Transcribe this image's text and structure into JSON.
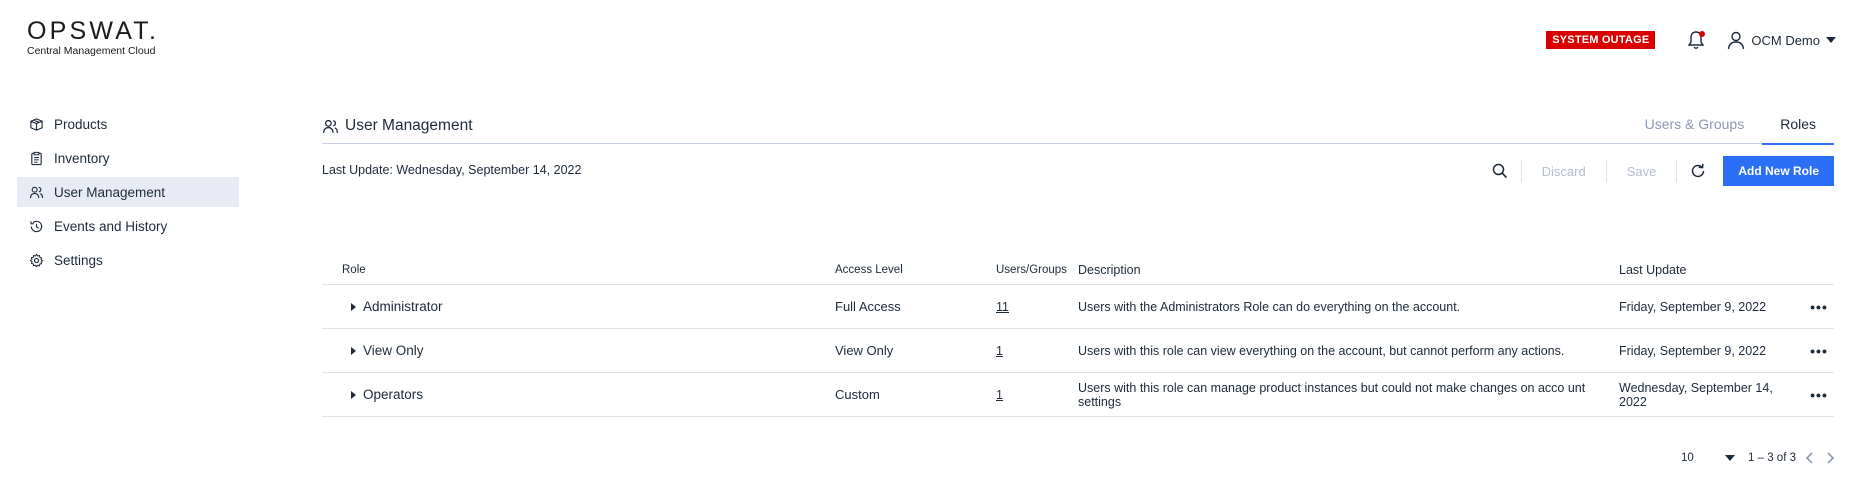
{
  "brand": {
    "name": "OPSWAT.",
    "subtitle": "Central Management Cloud"
  },
  "topbar": {
    "outage_badge": "SYSTEM OUTAGE",
    "user_name": "OCM Demo",
    "notification_dot_color": "#d80000"
  },
  "sidebar": {
    "items": [
      {
        "label": "Products",
        "icon": "box-icon"
      },
      {
        "label": "Inventory",
        "icon": "clipboard-icon"
      },
      {
        "label": "User Management",
        "icon": "users-icon",
        "active": true
      },
      {
        "label": "Events and History",
        "icon": "history-icon"
      },
      {
        "label": "Settings",
        "icon": "gear-icon"
      }
    ]
  },
  "main": {
    "title": "User Management",
    "tabs": [
      {
        "label": "Users & Groups"
      },
      {
        "label": "Roles",
        "active": true
      }
    ],
    "last_update": "Last Update: Wednesday, September 14, 2022",
    "toolbar": {
      "discard_label": "Discard",
      "save_label": "Save",
      "add_label": "Add New Role"
    }
  },
  "table": {
    "headers": {
      "role": "Role",
      "access": "Access Level",
      "users": "Users/Groups",
      "description": "Description",
      "last_update": "Last Update"
    },
    "rows": [
      {
        "role": "Administrator",
        "access": "Full Access",
        "users": "11",
        "description": "Users with the Administrators Role can do everything on the account.",
        "last_update": "Friday, September 9, 2022"
      },
      {
        "role": "View Only",
        "access": "View Only",
        "users": "1",
        "description": "Users with this role can view everything on the account, but cannot perform any actions.",
        "last_update": "Friday, September 9, 2022"
      },
      {
        "role": "Operators",
        "access": "Custom",
        "users": "1",
        "description": "Users with this role can manage product instances but could not make changes on acco unt settings",
        "last_update": "Wednesday, September 14, 2022"
      }
    ],
    "more_label": "•••"
  },
  "pagination": {
    "page_size": "10",
    "range": "1 – 3 of 3"
  },
  "colors": {
    "accent": "#2a6ff5",
    "outage": "#d80000",
    "active_nav_bg": "#e8ebf3"
  }
}
